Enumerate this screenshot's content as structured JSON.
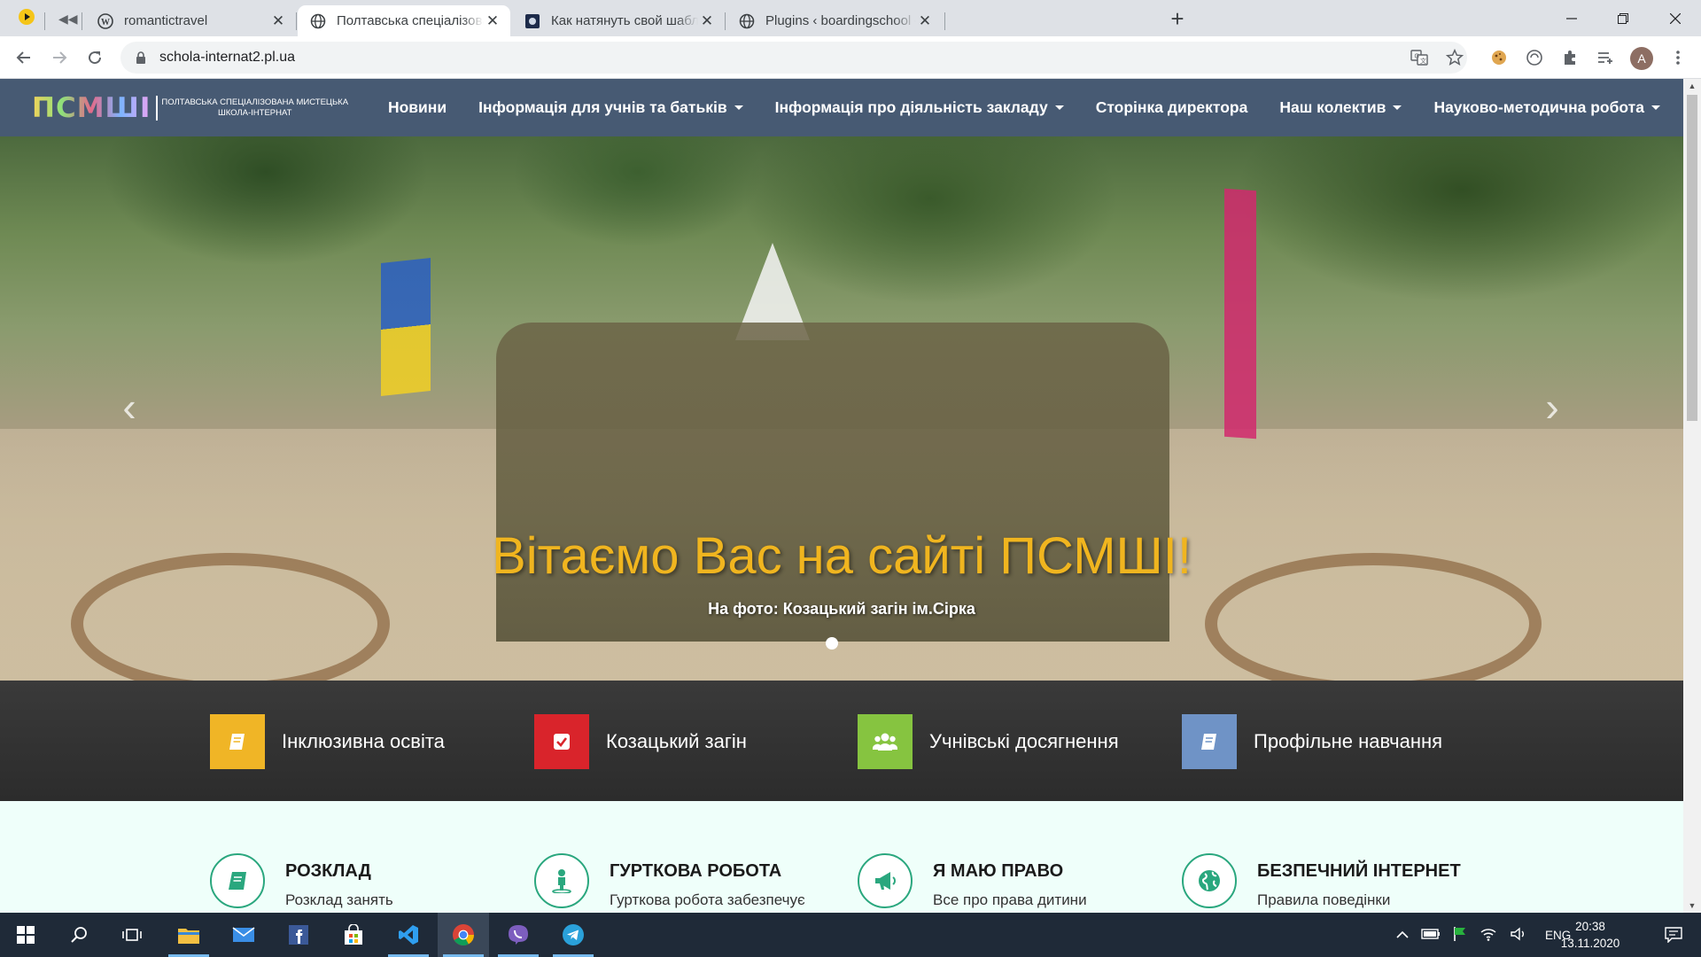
{
  "browser": {
    "tabs": [
      {
        "title": "romantictravel",
        "icon": "wordpress-icon"
      },
      {
        "title": "Полтавська спеціалізована мис",
        "icon": "globe-icon",
        "active": true
      },
      {
        "title": "Как натянуть свой шаблон на W",
        "icon": "page-icon"
      },
      {
        "title": "Plugins ‹ boardingschool — Word",
        "icon": "globe-icon"
      }
    ],
    "url": "schola-internat2.pl.ua",
    "profile_initial": "A"
  },
  "site": {
    "logo_mark": "ПСМШІ",
    "logo_sub_1": "Полтавська спеціалізована мистецька",
    "logo_sub_2": "школа-інтернат",
    "nav": [
      {
        "label": "Новини",
        "dropdown": false
      },
      {
        "label": "Інформація для учнів та батьків",
        "dropdown": true
      },
      {
        "label": "Інформація про діяльність закладу",
        "dropdown": true
      },
      {
        "label": "Сторінка директора",
        "dropdown": false
      },
      {
        "label": "Наш колектив",
        "dropdown": true
      },
      {
        "label": "Науково-методична робота",
        "dropdown": true
      }
    ],
    "hero": {
      "headline": "Вітаємо Вас на сайті ПСМШІ!",
      "caption": "На фото: Козацький загін ім.Сірка"
    },
    "features": [
      {
        "label": "Інклюзивна освіта",
        "color": "#f0b526",
        "icon": "book-icon"
      },
      {
        "label": "Козацький загін",
        "color": "#d9242b",
        "icon": "check-square-icon"
      },
      {
        "label": "Учнівські досягнення",
        "color": "#86c440",
        "icon": "users-icon"
      },
      {
        "label": "Профільне навчання",
        "color": "#6f93c6",
        "icon": "book-icon"
      }
    ],
    "services": [
      {
        "title": "РОЗКЛАД",
        "text": "Розклад занять",
        "icon": "book-icon"
      },
      {
        "title": "ГУРТКОВА РОБОТА",
        "text": "Гурткова робота забезпечує",
        "icon": "person-icon"
      },
      {
        "title": "Я МАЮ ПРАВО",
        "text": "Все про права дитини",
        "icon": "megaphone-icon"
      },
      {
        "title": "БЕЗПЕЧНИЙ ІНТЕРНЕТ",
        "text": "Правила поведінки",
        "icon": "globe-icon"
      }
    ],
    "accent_color": "#2aa77e",
    "nav_bg": "#475a73"
  },
  "taskbar": {
    "language": "ENG",
    "time": "20:38",
    "date": "13.11.2020"
  }
}
